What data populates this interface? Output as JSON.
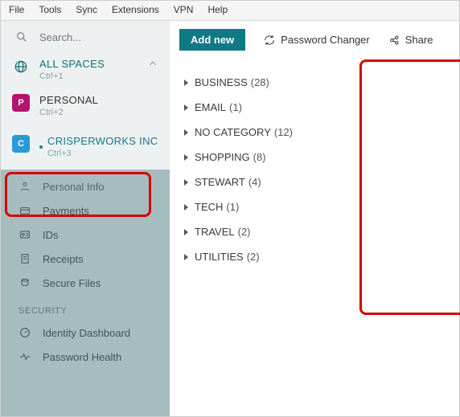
{
  "menu": [
    "File",
    "Tools",
    "Sync",
    "Extensions",
    "VPN",
    "Help"
  ],
  "search": {
    "placeholder": "Search..."
  },
  "spaces": {
    "all": {
      "label": "ALL SPACES",
      "shortcut": "Ctrl+1"
    },
    "personal": {
      "label": "PERSONAL",
      "shortcut": "Ctrl+2",
      "letter": "P"
    },
    "crisper": {
      "label": "CRISPERWORKS INC",
      "shortcut": "Ctrl+3",
      "letter": "C"
    }
  },
  "nav": {
    "personal_info": "Personal Info",
    "payments": "Payments",
    "ids": "IDs",
    "receipts": "Receipts",
    "secure_files": "Secure Files",
    "section_security": "SECURITY",
    "identity_dashboard": "Identity Dashboard",
    "password_health": "Password Health"
  },
  "toolbar": {
    "add_new": "Add new",
    "pw_changer": "Password Changer",
    "share": "Share"
  },
  "categories": [
    {
      "name": "BUSINESS",
      "count": "(28)"
    },
    {
      "name": "EMAIL",
      "count": "(1)"
    },
    {
      "name": "NO CATEGORY",
      "count": "(12)"
    },
    {
      "name": "SHOPPING",
      "count": "(8)"
    },
    {
      "name": "STEWART",
      "count": "(4)"
    },
    {
      "name": "TECH",
      "count": "(1)"
    },
    {
      "name": "TRAVEL",
      "count": "(2)"
    },
    {
      "name": "UTILITIES",
      "count": "(2)"
    }
  ]
}
